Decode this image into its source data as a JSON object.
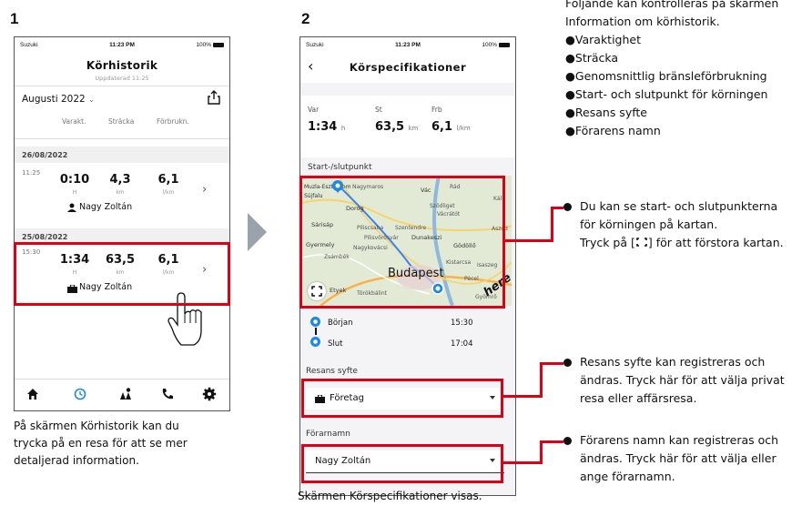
{
  "steps": {
    "one": "1",
    "two": "2"
  },
  "status": {
    "carrier": "Suzuki",
    "time": "11:23 PM",
    "battery": "100%"
  },
  "screen1": {
    "title": "Körhistorik",
    "updated": "Uppdaterad 11:25",
    "month": "Augusti 2022",
    "columns": [
      "Varakt.",
      "Sträcka",
      "Förbrukn."
    ],
    "trips": [
      {
        "date": "26/08/2022",
        "time": "11:25",
        "duration": "0:10",
        "duration_unit": "H",
        "distance": "4,3",
        "distance_unit": "km",
        "consumption": "6,1",
        "consumption_unit": "l/km",
        "driver": "Nagy Zoltán",
        "purpose_icon": "person-icon"
      },
      {
        "date": "25/08/2022",
        "time": "15:30",
        "duration": "1:34",
        "duration_unit": "H",
        "distance": "63,5",
        "distance_unit": "km",
        "consumption": "6,1",
        "consumption_unit": "l/km",
        "driver": "Nagy Zoltán",
        "purpose_icon": "briefcase-icon"
      }
    ],
    "nav_icons": [
      "home-icon",
      "history-icon",
      "map-icon",
      "phone-icon",
      "settings-icon"
    ],
    "caption": [
      "På skärmen Körhistorik kan du",
      "trycka på en resa för att se mer",
      "detaljerad information."
    ]
  },
  "screen2": {
    "title": "Körspecifikationer",
    "stats": [
      {
        "label": "Var",
        "value": "1:34",
        "unit": "h"
      },
      {
        "label": "St",
        "value": "63,5",
        "unit": "km"
      },
      {
        "label": "Frb",
        "value": "6,1",
        "unit": "l/km"
      }
    ],
    "route_label": "Start-/slutpunkt",
    "map_labels": {
      "a": "Muzla-Esztergom",
      "b": "Nagymaros",
      "c": "Vác",
      "d": "Rád",
      "e": "Süjfalu",
      "f": "Dorog",
      "g": "Szödliget",
      "h": "Vácrátót",
      "i": "Kál",
      "j": "Sárisáp",
      "k": "Piliscsaba",
      "l": "Szentendre",
      "m": "Aszód",
      "n": "Pilisvörösvár",
      "o": "Dunakeszi",
      "p": "Gyermely",
      "q": "Nagykovácsi",
      "r": "Gödöllő",
      "s": "Zsámbék",
      "t": "Kistarcsa",
      "u": "Isaszeg",
      "v": "Budapest",
      "w": "Pécel",
      "x": "Etyek",
      "y": "Törökbálint",
      "z": "Gyömrő",
      "brand": "here"
    },
    "start_label": "Början",
    "start_time": "15:30",
    "end_label": "Slut",
    "end_time": "17:04",
    "purpose_label": "Resans syfte",
    "purpose_value": "Företag",
    "driver_label": "Förarnamn",
    "driver_value": "Nagy Zoltán",
    "caption": "Skärmen Körspecifikationer visas."
  },
  "notes": {
    "intro": [
      "Följande kan kontrolleras på skärmen",
      "Information om körhistorik."
    ],
    "items": [
      "●Varaktighet",
      "●Sträcka",
      "●Genomsnittlig bränsleförbrukning",
      "●Start- och slutpunkt för körningen",
      "●Resans syfte",
      "●Förarens namn"
    ],
    "map_note": [
      "Du kan se start- och slutpunkterna",
      "för körningen på kartan.",
      "Tryck på [",
      "] för att förstora kartan."
    ],
    "purpose_note": [
      "Resans syfte kan registreras och",
      "ändras. Tryck här för att välja privat",
      "resa eller affärsresa."
    ],
    "driver_note": [
      "Förarens namn kan registreras och",
      "ändras. Tryck här för att välja eller",
      "ange förarnamn."
    ]
  },
  "colors": {
    "highlight": "#e00016",
    "accent": "#2196f3"
  }
}
